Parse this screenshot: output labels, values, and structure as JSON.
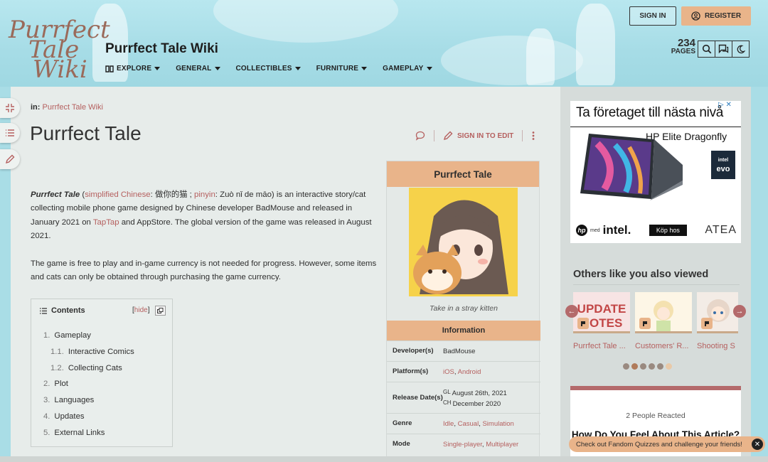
{
  "header": {
    "logo_lines": [
      "Purrfect",
      "Tale",
      "Wiki"
    ],
    "site_title": "Purrfect Tale Wiki",
    "nav": [
      "EXPLORE",
      "GENERAL",
      "COLLECTIBLES",
      "FURNITURE",
      "GAMEPLAY"
    ],
    "sign_in": "SIGN IN",
    "register": "REGISTER",
    "pages_count": "234",
    "pages_label": "PAGES"
  },
  "article": {
    "breadcrumb_prefix": "in:",
    "breadcrumb_link": "Purrfect Tale Wiki",
    "title": "Purrfect Tale",
    "sign_in_to_edit": "SIGN IN TO EDIT",
    "intro": {
      "name": "Purrfect Tale",
      "open": " (",
      "link1": "simplified Chinese",
      "mid1": ": 做你的猫 ; ",
      "link2": "pinyin",
      "mid2": ": Zuò nǐ de māo) is an interactive story/cat collecting mobile phone game designed by Chinese developer BadMouse and released in January 2021 on ",
      "link3": "TapTap",
      "end": " and AppStore. The global version of the game was released in August 2021."
    },
    "para2": "The game is free to play and in-game currency is not needed for progress. However, some items and cats can only be obtained through purchasing the game currency."
  },
  "toc": {
    "title": "Contents",
    "hide": "hide",
    "items": [
      {
        "num": "1.",
        "label": "Gameplay"
      },
      {
        "num": "1.1.",
        "label": "Interactive Comics"
      },
      {
        "num": "1.2.",
        "label": "Collecting Cats"
      },
      {
        "num": "2.",
        "label": "Plot"
      },
      {
        "num": "3.",
        "label": "Languages"
      },
      {
        "num": "4.",
        "label": "Updates"
      },
      {
        "num": "5.",
        "label": "External Links"
      }
    ]
  },
  "infobox": {
    "title": "Purrfect Tale",
    "caption": "Take in a stray kitten",
    "section": "Information",
    "rows": [
      {
        "label": "Developer(s)",
        "value": "BadMouse"
      },
      {
        "label": "Platform(s)",
        "link1": "iOS",
        "sep": ", ",
        "link2": "Android"
      },
      {
        "label": "Release Date(s)",
        "gl_tag": "GL",
        "gl": "August 26th, 2021",
        "ch_tag": "CH",
        "ch": "December 2020"
      },
      {
        "label": "Genre",
        "link1": "Idle",
        "link2": "Casual",
        "link3": "Simulation"
      },
      {
        "label": "Mode",
        "link1": "Single-player",
        "link2": "Multiplayer"
      }
    ]
  },
  "ad": {
    "headline": "Ta företaget till nästa nivå",
    "model": "HP Elite Dragonfly G3",
    "hp": "hp",
    "med": "med",
    "intel": "intel.",
    "buy": "Köp hos",
    "partner": "ATEA",
    "badge_top": "intel",
    "badge_bottom": "evo",
    "close": "▷ ✕"
  },
  "others": {
    "title": "Others like you also viewed",
    "items": [
      "Purrfect Tale ...",
      "Customers' R...",
      "Shooting S"
    ],
    "thumb1_text": "UPDATE NOTES"
  },
  "reactions": {
    "count": "2 People Reacted",
    "question": "How Do You Feel About This Article?"
  },
  "toast": {
    "text": "Check out Fandom Quizzes and challenge your friends!"
  },
  "colors": {
    "accent": "#b5605f",
    "peach": "#e9b48a",
    "header_bg": "#a9dde6"
  }
}
